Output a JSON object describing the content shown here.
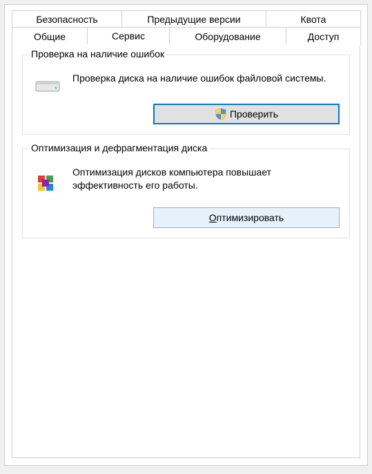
{
  "tabs_row1": [
    {
      "label": "Безопасность"
    },
    {
      "label": "Предыдущие версии"
    },
    {
      "label": "Квота"
    }
  ],
  "tabs_row2": [
    {
      "label": "Общие"
    },
    {
      "label": "Сервис",
      "active": true
    },
    {
      "label": "Оборудование"
    },
    {
      "label": "Доступ"
    }
  ],
  "group_check": {
    "title": "Проверка на наличие ошибок",
    "description": "Проверка диска на наличие ошибок файловой системы.",
    "button": "Проверить"
  },
  "group_optimize": {
    "title": "Оптимизация и дефрагментация диска",
    "description": "Оптимизация дисков компьютера повышает эффективность его работы.",
    "button": "Оптимизировать"
  }
}
